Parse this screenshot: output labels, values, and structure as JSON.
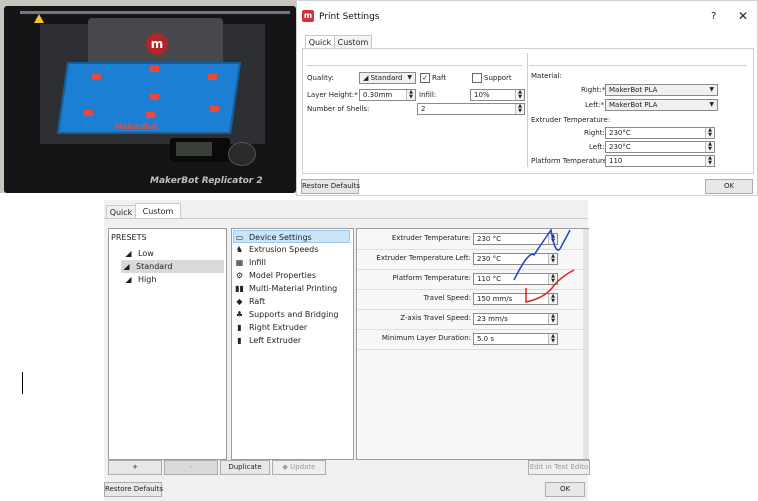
{
  "photo": {
    "head_logo": "m",
    "bed_label": "MakerBot",
    "brand": "MakerBot Replicator 2"
  },
  "print_settings": {
    "title": "Print Settings",
    "help_label": "?",
    "close_label": "✕",
    "tabs": [
      "Quick",
      "Custom"
    ],
    "quality": {
      "label": "Quality:",
      "value": "Standard"
    },
    "raft": {
      "label": "Raft",
      "checked": true
    },
    "support": {
      "label": "Support",
      "checked": false
    },
    "layer_height": {
      "label": "Layer Height:*",
      "value": "0.30mm"
    },
    "infill": {
      "label": "Infill:",
      "value": "10%"
    },
    "shells": {
      "label": "Number of Shells:",
      "value": "2"
    },
    "material": {
      "label": "Material:",
      "right_label": "Right:*",
      "right_value": "MakerBot PLA",
      "left_label": "Left:*",
      "left_value": "MakerBot PLA"
    },
    "extruder_temp": {
      "label": "Extruder Temperature:",
      "right_label": "Right:",
      "right_value": "230°C",
      "left_label": "Left:",
      "left_value": "230°C"
    },
    "platform_temp": {
      "label": "Platform Temperature:",
      "value": "110"
    },
    "restore_label": "Restore Defaults",
    "ok_label": "OK"
  },
  "custom": {
    "tabs": [
      "Quick",
      "Custom"
    ],
    "presets_title": "PRESETS",
    "presets": [
      "Low",
      "Standard",
      "High"
    ],
    "selected_preset": "Standard",
    "categories": [
      {
        "label": "Device Settings",
        "icon": "monitor-icon"
      },
      {
        "label": "Extrusion Speeds",
        "icon": "rabbit-icon"
      },
      {
        "label": "Infill",
        "icon": "grid-icon"
      },
      {
        "label": "Model Properties",
        "icon": "gear-icon"
      },
      {
        "label": "Multi-Material Printing",
        "icon": "dual-extruder-icon"
      },
      {
        "label": "Raft",
        "icon": "layers-icon"
      },
      {
        "label": "Supports and Bridging",
        "icon": "support-icon"
      },
      {
        "label": "Right Extruder",
        "icon": "extruder-icon"
      },
      {
        "label": "Left Extruder",
        "icon": "extruder-icon"
      }
    ],
    "settings": [
      {
        "label": "Extruder Temperature:",
        "value": "230 °C"
      },
      {
        "label": "Extruder Temperature Left:",
        "value": "230 °C"
      },
      {
        "label": "Platform Temperature:",
        "value": "110 °C"
      },
      {
        "label": "Travel Speed:",
        "value": "150 mm/s"
      },
      {
        "label": "Z-axis Travel Speed:",
        "value": "23 mm/s"
      },
      {
        "label": "Minimum Layer Duration:",
        "value": "5.0 s"
      }
    ],
    "buttons": {
      "add": "+",
      "remove": "-",
      "duplicate": "Duplicate",
      "update": "Update",
      "edit": "Edit in Text Edito"
    },
    "restore_label": "Restore Defaults",
    "ok_label": "OK"
  },
  "annotation_colors": {
    "blue": "#1f3fd0",
    "red": "#e0201c"
  }
}
